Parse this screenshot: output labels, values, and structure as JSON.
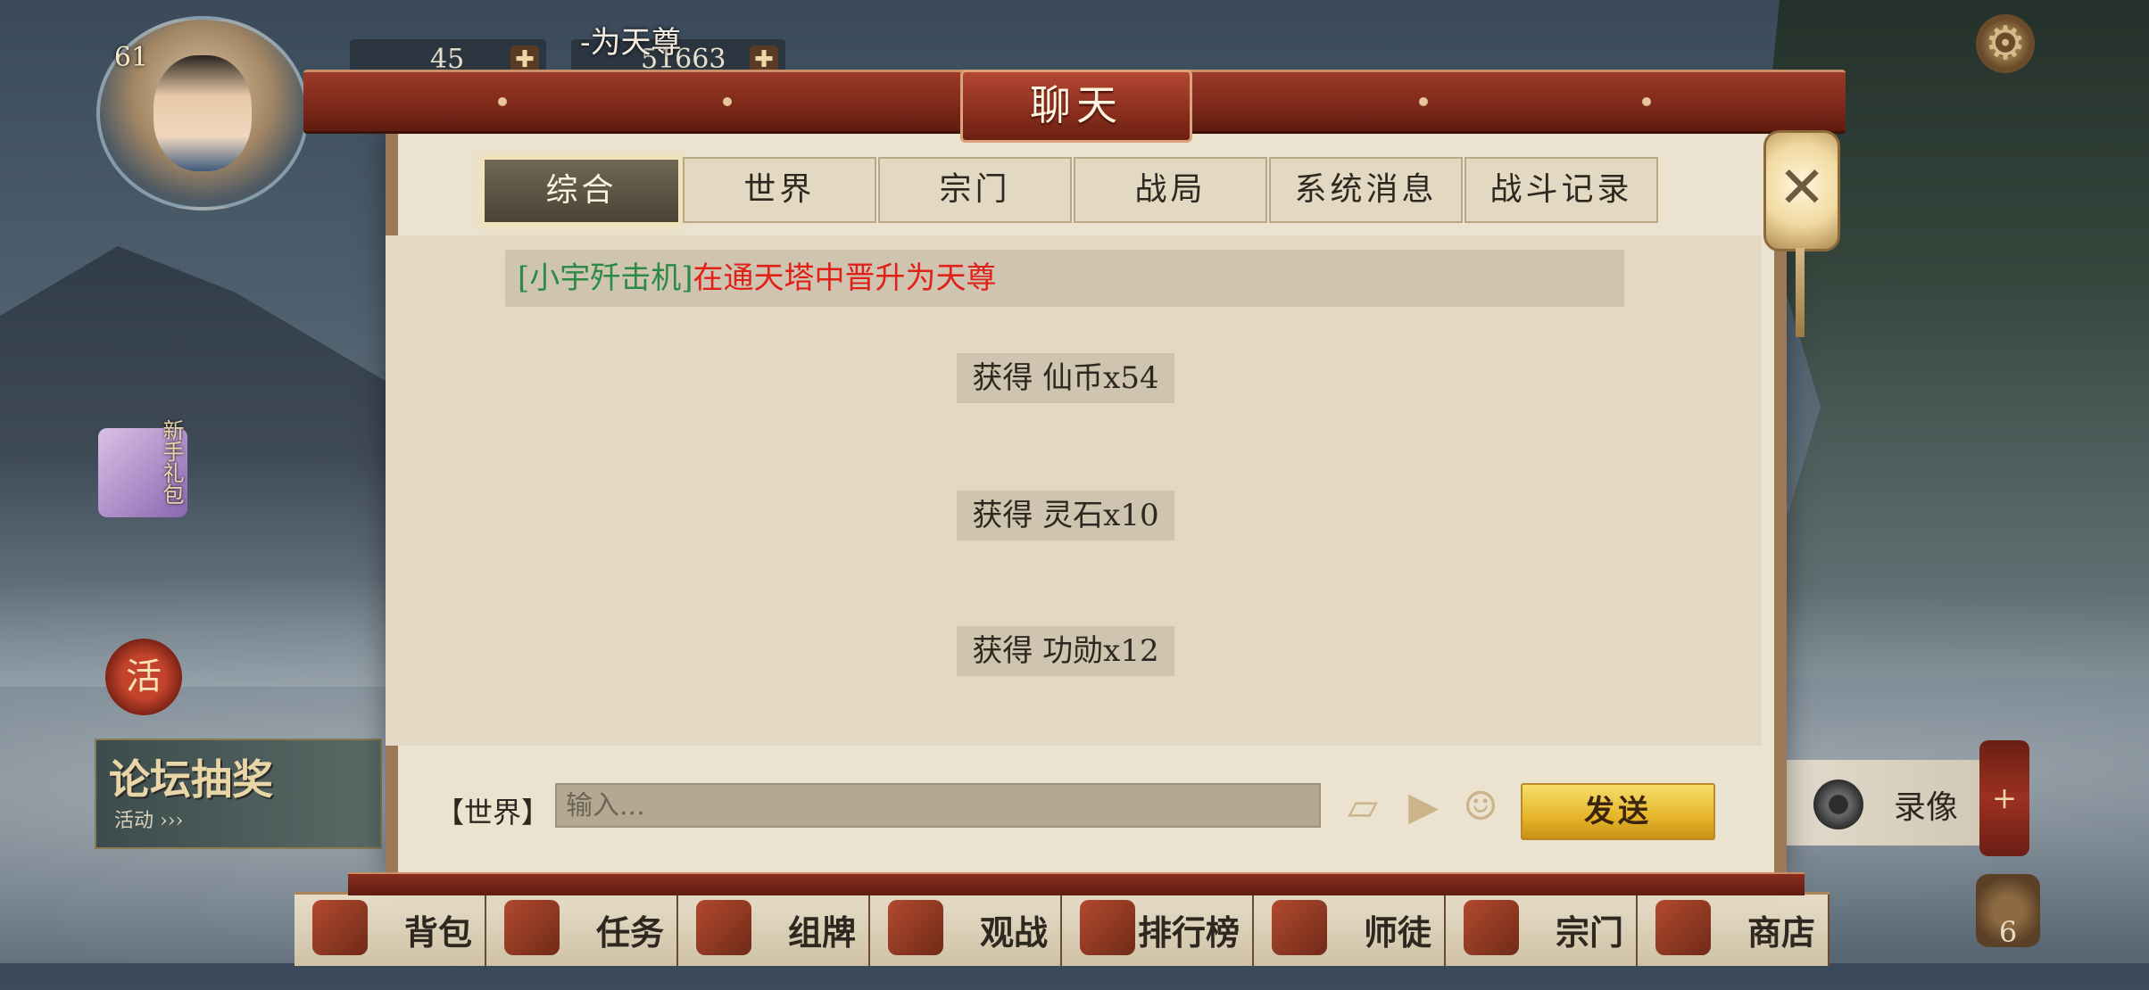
{
  "hud": {
    "level": "61",
    "currency_a": "45",
    "currency_b": "51663",
    "marquee_text": "-为天尊"
  },
  "side_left": {
    "gift_label": "新手礼包",
    "activity_label": "活",
    "forum_title": "论坛抽奖",
    "forum_sub": "活动 ›››"
  },
  "side_right": {
    "record_label": "录像",
    "record_cut_char": "ᐳ",
    "plus_label": "+",
    "bag_count": "6"
  },
  "dialog": {
    "title": "聊天",
    "tabs": [
      "综合",
      "世界",
      "宗门",
      "战局",
      "系统消息",
      "战斗记录"
    ],
    "active_tab": "综合",
    "messages": {
      "broadcast_name": "[小宇歼击机]",
      "broadcast_text": "在通天塔中晋升为天尊",
      "reward_1": "获得 仙币x54",
      "reward_2": "获得 灵石x10",
      "reward_3": "获得 功勋x12"
    },
    "input": {
      "channel": "【世界】",
      "placeholder": "输入...",
      "send_label": "发送"
    }
  },
  "bottom_menu": [
    {
      "label": "背包"
    },
    {
      "label": "任务"
    },
    {
      "label": "组牌"
    },
    {
      "label": "观战"
    },
    {
      "label": "排行榜"
    },
    {
      "label": "师徒"
    },
    {
      "label": "宗门"
    },
    {
      "label": "商店"
    }
  ],
  "colors": {
    "dialog_bg": "#ebe2cf",
    "frame_red": "#8a2d1e",
    "name_green": "#2a8a46",
    "text_red": "#e1201a",
    "send_gold": "#e6b52a"
  },
  "icons": {
    "close": "close-icon",
    "settings": "gear-icon",
    "card": "card-icon",
    "video": "video-icon",
    "emoji": "smiley-icon"
  }
}
